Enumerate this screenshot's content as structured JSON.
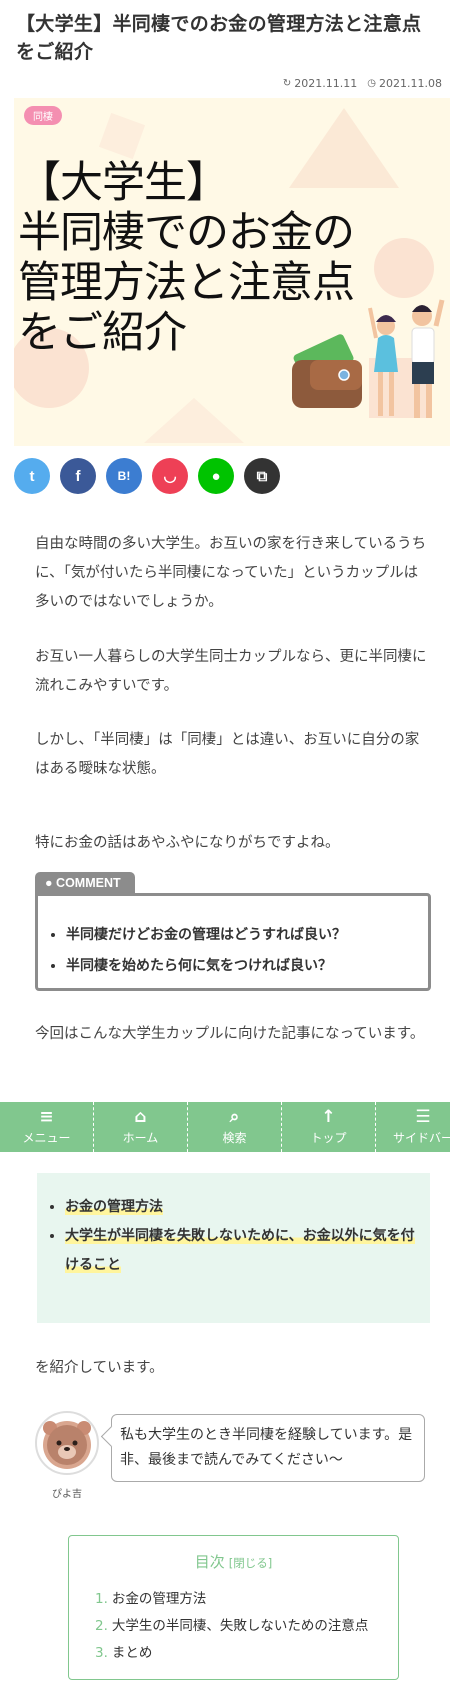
{
  "article": {
    "title": "【大学生】半同棲でのお金の管理方法と注意点をご紹介",
    "updated_date": "2021.11.11",
    "published_date": "2021.11.08",
    "category_badge": "同棲",
    "eyecatch_text": [
      "【大学生】",
      "半同棲でのお金の",
      "管理方法と注意点",
      "をご紹介"
    ]
  },
  "share_buttons": [
    {
      "name": "twitter",
      "glyph": "t",
      "color": "#55acee"
    },
    {
      "name": "facebook",
      "glyph": "f",
      "color": "#3b5998"
    },
    {
      "name": "hatena",
      "glyph": "B!",
      "color": "#3c7dd1"
    },
    {
      "name": "pocket",
      "glyph": "◡",
      "color": "#ee4056"
    },
    {
      "name": "line",
      "glyph": "●",
      "color": "#00c300"
    },
    {
      "name": "copy",
      "glyph": "⧉",
      "color": "#333333"
    }
  ],
  "intro_paragraphs": [
    "自由な時間の多い大学生。お互いの家を行き来しているうちに、「気が付いたら半同棲になっていた」というカップルは多いのではないでしょうか。",
    "お互い一人暮らしの大学生同士カップルなら、更に半同棲に流れこみやすいです。",
    "しかし、「半同棲」は「同棲」とは違い、お互いに自分の家はある曖昧な状態。",
    "特にお金の話はあやふやになりがちですよね。"
  ],
  "comment": {
    "label": "COMMENT",
    "items": [
      "半同棲だけどお金の管理はどうすれば良い？",
      "半同棲を始めたら何に気をつければ良い？"
    ]
  },
  "target_paragraph": "今回はこんな大学生カップルに向けた記事になっています。",
  "bottom_nav": [
    {
      "icon": "≡",
      "label": "メニュー"
    },
    {
      "icon": "⌂",
      "label": "ホーム"
    },
    {
      "icon": "⌕",
      "label": "検索"
    },
    {
      "icon": "↑",
      "label": "トップ"
    },
    {
      "icon": "☰",
      "label": "サイドバー"
    }
  ],
  "topics": [
    "お金の管理方法",
    "大学生が半同棲を失敗しないために、お金以外に気を付けること"
  ],
  "topics_suffix": "を紹介しています。",
  "speech": {
    "name": "ぴよ吉",
    "text": "私も大学生のとき半同棲を経験しています。是非、最後まで読んでみてください〜"
  },
  "toc": {
    "title": "目次",
    "toggle": "[閉じる]",
    "items": [
      {
        "num": "1.",
        "text": "お金の管理方法"
      },
      {
        "num": "2.",
        "text": "大学生の半同棲、失敗しないための注意点"
      },
      {
        "num": "3.",
        "text": "まとめ"
      }
    ]
  },
  "colors": {
    "accent_green": "#81c78e",
    "comment_gray": "#8c8c8c",
    "highlight_yellow": "#fff59d",
    "badge_pink": "#f48fb1"
  }
}
